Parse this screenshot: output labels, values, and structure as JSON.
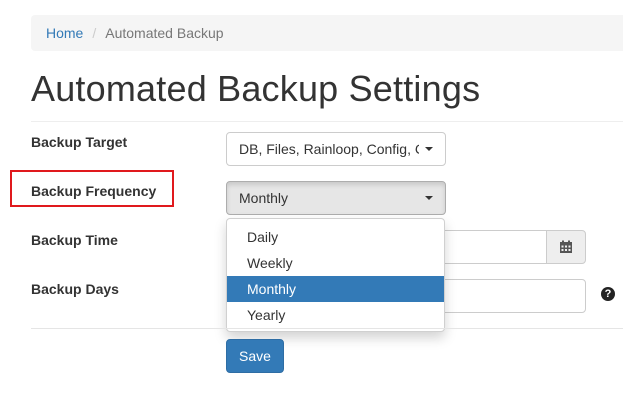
{
  "breadcrumb": {
    "home": "Home",
    "separator": "/",
    "current": "Automated Backup"
  },
  "page_title": "Automated Backup Settings",
  "form": {
    "backup_target": {
      "label": "Backup Target",
      "value": "DB, Files, Rainloop, Config, C"
    },
    "backup_frequency": {
      "label": "Backup Frequency",
      "value": "Monthly",
      "options": [
        "Daily",
        "Weekly",
        "Monthly",
        "Yearly"
      ],
      "selected_option": "Monthly"
    },
    "backup_time": {
      "label": "Backup Time",
      "value": "",
      "addon_icon": "calendar-icon"
    },
    "backup_days": {
      "label": "Backup Days",
      "value": "",
      "help_icon": "question-circle-icon",
      "help_glyph": "?"
    }
  },
  "save_label": "Save",
  "colors": {
    "primary": "#337ab7",
    "highlight_border": "#e0191d"
  }
}
